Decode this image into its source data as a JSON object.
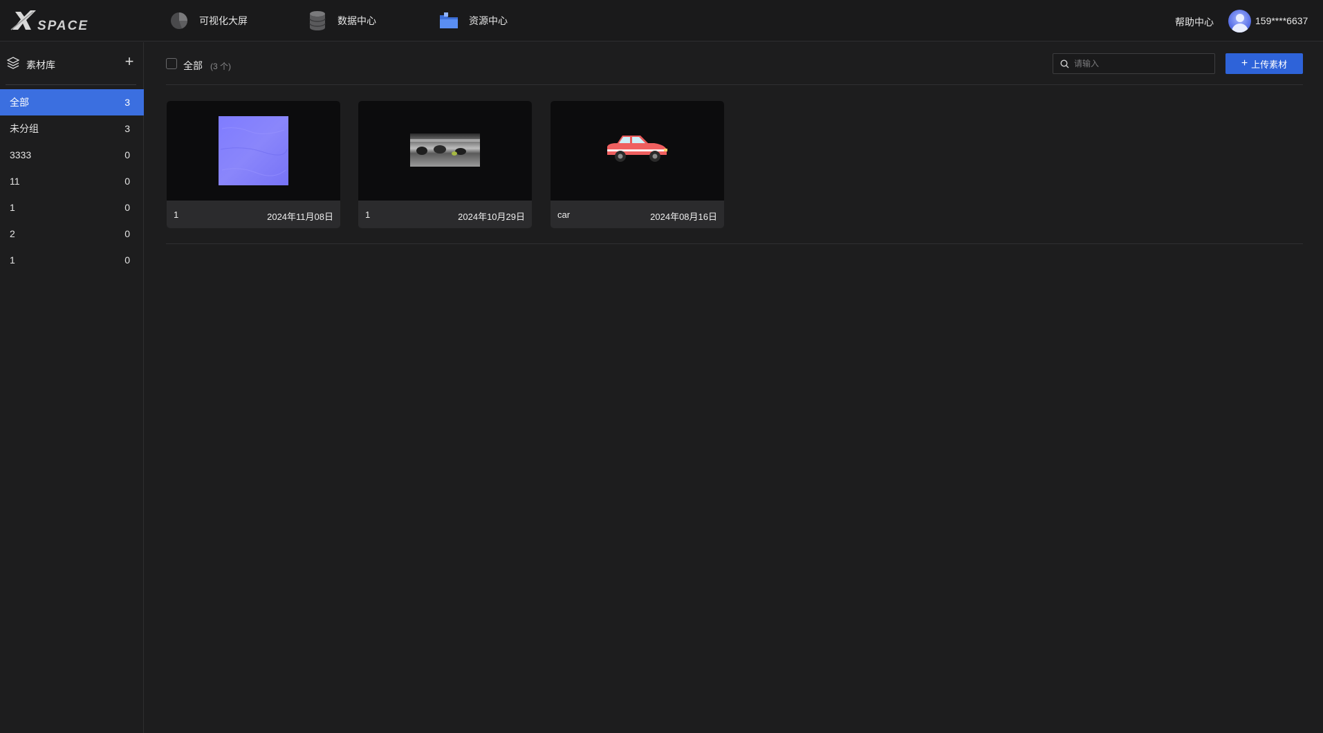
{
  "app": {
    "logo_text": "XSPACE"
  },
  "nav": {
    "items": [
      {
        "label": "可视化大屏",
        "icon": "pie-chart-icon"
      },
      {
        "label": "数据中心",
        "icon": "database-icon"
      },
      {
        "label": "资源中心",
        "icon": "folder-icon"
      }
    ],
    "help": "帮助中心",
    "username": "159****6637"
  },
  "sidebar": {
    "title": "素材库",
    "items": [
      {
        "label": "全部",
        "count": "3",
        "active": true
      },
      {
        "label": "未分组",
        "count": "3"
      },
      {
        "label": "3333",
        "count": "0"
      },
      {
        "label": "11",
        "count": "0"
      },
      {
        "label": "1",
        "count": "0"
      },
      {
        "label": "2",
        "count": "0"
      },
      {
        "label": "1",
        "count": "0"
      }
    ]
  },
  "toolbar": {
    "all_label": "全部",
    "count_label": "(3 个)",
    "search_placeholder": "请输入",
    "upload_label": "上传素材"
  },
  "cards": [
    {
      "name": "1",
      "date": "2024年11月08日",
      "thumb": "normal-map-texture"
    },
    {
      "name": "1",
      "date": "2024年10月29日",
      "thumb": "panorama-image"
    },
    {
      "name": "car",
      "date": "2024年08月16日",
      "thumb": "car-model"
    }
  ],
  "colors": {
    "accent": "#3b6fe0",
    "button": "#2e63d9",
    "background": "#1d1d1e"
  }
}
